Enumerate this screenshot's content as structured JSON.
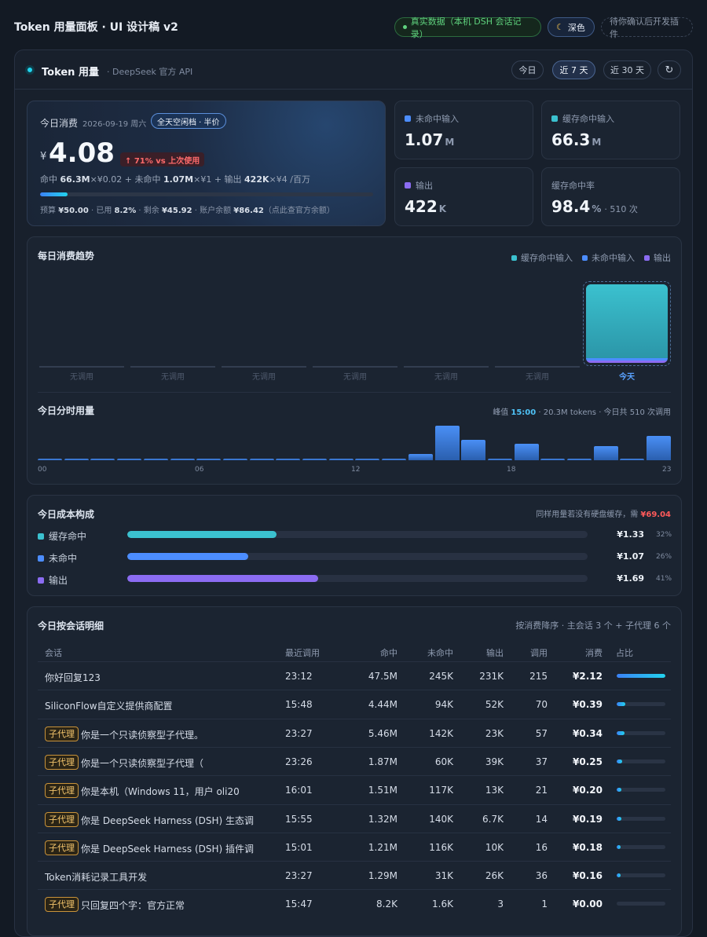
{
  "app": {
    "title": "Token 用量面板 · UI 设计稿 v2"
  },
  "topbar": {
    "real_data": "真实数据（本机 DSH 会话记录）",
    "theme": "深色",
    "pending": "待你确认后开发插件"
  },
  "header": {
    "title": "Token 用量",
    "subtitle": "· DeepSeek 官方 API",
    "ranges": [
      "今日",
      "近 7 天",
      "近 30 天"
    ],
    "active_range": "近 7 天",
    "refresh_icon": "refresh-icon"
  },
  "today": {
    "label": "今日消费",
    "date": "2026-09-19 周六",
    "badge": "全天空闲档 · 半价",
    "currency": "¥",
    "amount": "4.08",
    "change": "↑ 71% vs 上次使用",
    "formula": {
      "hit_label": "命中 ",
      "hit_value": "66.3M",
      "hit_price": "×¥0.02 + 未命中 ",
      "miss_value": "1.07M",
      "miss_price": "×¥1 + 输出 ",
      "out_value": "422K",
      "out_price": "×¥4  /百万"
    },
    "budget_used_fraction": 0.082,
    "budget": {
      "p1": "预算 ",
      "budget_value": "¥50.00",
      "p2": " · 已用 ",
      "used_pct": "8.2%",
      "p3": " · 剩余 ",
      "remaining": "¥45.92",
      "p4": " · 账户余额 ",
      "balance": "¥86.42",
      "p5": "（点此查官方余额）"
    }
  },
  "stats": [
    {
      "label": "未命中输入",
      "value": "1.07",
      "unit": "M",
      "extra": "",
      "color": "#4c8dff"
    },
    {
      "label": "缓存命中输入",
      "value": "66.3",
      "unit": "M",
      "extra": "",
      "color": "#3bc1cf"
    },
    {
      "label": "输出",
      "value": "422",
      "unit": "K",
      "extra": "",
      "color": "#8b6cf2"
    },
    {
      "label": "缓存命中率",
      "value": "98.4",
      "unit": "%",
      "extra": "· 510 次",
      "color": ""
    }
  ],
  "daily": {
    "title": "每日消费趋势",
    "legend": [
      "缓存命中输入",
      "未命中输入",
      "输出"
    ],
    "legend_colors": [
      "#3bc1cf",
      "#4c8dff",
      "#8b6cf2"
    ],
    "days": [
      "无调用",
      "无调用",
      "无调用",
      "无调用",
      "无调用",
      "无调用",
      "今天"
    ]
  },
  "hourly": {
    "title": "今日分时用量",
    "info_prefix": "峰值 ",
    "peak_hour": "15:00",
    "info_suffix": " · 20.3M tokens · 今日共 510 次调用",
    "ticks": [
      "00",
      "06",
      "12",
      "18",
      "23"
    ],
    "values": [
      0.03,
      0.03,
      0.03,
      0.03,
      0.03,
      0.03,
      0.03,
      0.03,
      0.03,
      0.03,
      0.03,
      0.03,
      0.03,
      0.03,
      0.18,
      1.0,
      0.6,
      0.03,
      0.47,
      0.03,
      0.03,
      0.42,
      0.03,
      0.7
    ]
  },
  "cost": {
    "title": "今日成本构成",
    "note_prefix": "同样用量若没有硬盘缓存，需 ",
    "note_value": "¥69.04",
    "rows": [
      {
        "label": "缓存命中",
        "amount": "¥1.33",
        "pct": "32%",
        "fraction": 0.325,
        "color": "#3bc1cf"
      },
      {
        "label": "未命中",
        "amount": "¥1.07",
        "pct": "26%",
        "fraction": 0.262,
        "color": "#4c8dff"
      },
      {
        "label": "输出",
        "amount": "¥1.69",
        "pct": "41%",
        "fraction": 0.414,
        "color": "#8b6cf2"
      }
    ]
  },
  "sessions": {
    "title": "今日按会话明细",
    "note": "按消费降序 · 主会话 3 个 + 子代理 6 个",
    "columns": [
      "会话",
      "最近调用",
      "命中",
      "未命中",
      "输出",
      "调用",
      "消费",
      "占比"
    ],
    "tag": "子代理",
    "rows": [
      {
        "sub": false,
        "name": "你好回复123",
        "last": "23:12",
        "hit": "47.5M",
        "miss": "245K",
        "out": "231K",
        "calls": "215",
        "cost": "¥2.12",
        "share": 1.0
      },
      {
        "sub": false,
        "name": "SiliconFlow自定义提供商配置",
        "last": "15:48",
        "hit": "4.44M",
        "miss": "94K",
        "out": "52K",
        "calls": "70",
        "cost": "¥0.39",
        "share": 0.18
      },
      {
        "sub": true,
        "name": "你是一个只读侦察型子代理。",
        "last": "23:27",
        "hit": "5.46M",
        "miss": "142K",
        "out": "23K",
        "calls": "57",
        "cost": "¥0.34",
        "share": 0.16
      },
      {
        "sub": true,
        "name": "你是一个只读侦察型子代理（",
        "last": "23:26",
        "hit": "1.87M",
        "miss": "60K",
        "out": "39K",
        "calls": "37",
        "cost": "¥0.25",
        "share": 0.12
      },
      {
        "sub": true,
        "name": "你是本机（Windows 11，用户 oli20",
        "last": "16:01",
        "hit": "1.51M",
        "miss": "117K",
        "out": "13K",
        "calls": "21",
        "cost": "¥0.20",
        "share": 0.095
      },
      {
        "sub": true,
        "name": "你是 DeepSeek Harness (DSH) 生态调",
        "last": "15:55",
        "hit": "1.32M",
        "miss": "140K",
        "out": "6.7K",
        "calls": "14",
        "cost": "¥0.19",
        "share": 0.09
      },
      {
        "sub": true,
        "name": "你是 DeepSeek Harness (DSH) 插件调",
        "last": "15:01",
        "hit": "1.21M",
        "miss": "116K",
        "out": "10K",
        "calls": "16",
        "cost": "¥0.18",
        "share": 0.085
      },
      {
        "sub": false,
        "name": "Token消耗记录工具开发",
        "last": "23:27",
        "hit": "1.29M",
        "miss": "31K",
        "out": "26K",
        "calls": "36",
        "cost": "¥0.16",
        "share": 0.075
      },
      {
        "sub": true,
        "name": "只回复四个字：官方正常",
        "last": "15:47",
        "hit": "8.2K",
        "miss": "1.6K",
        "out": "3",
        "calls": "1",
        "cost": "¥0.00",
        "share": 0.0
      }
    ]
  }
}
